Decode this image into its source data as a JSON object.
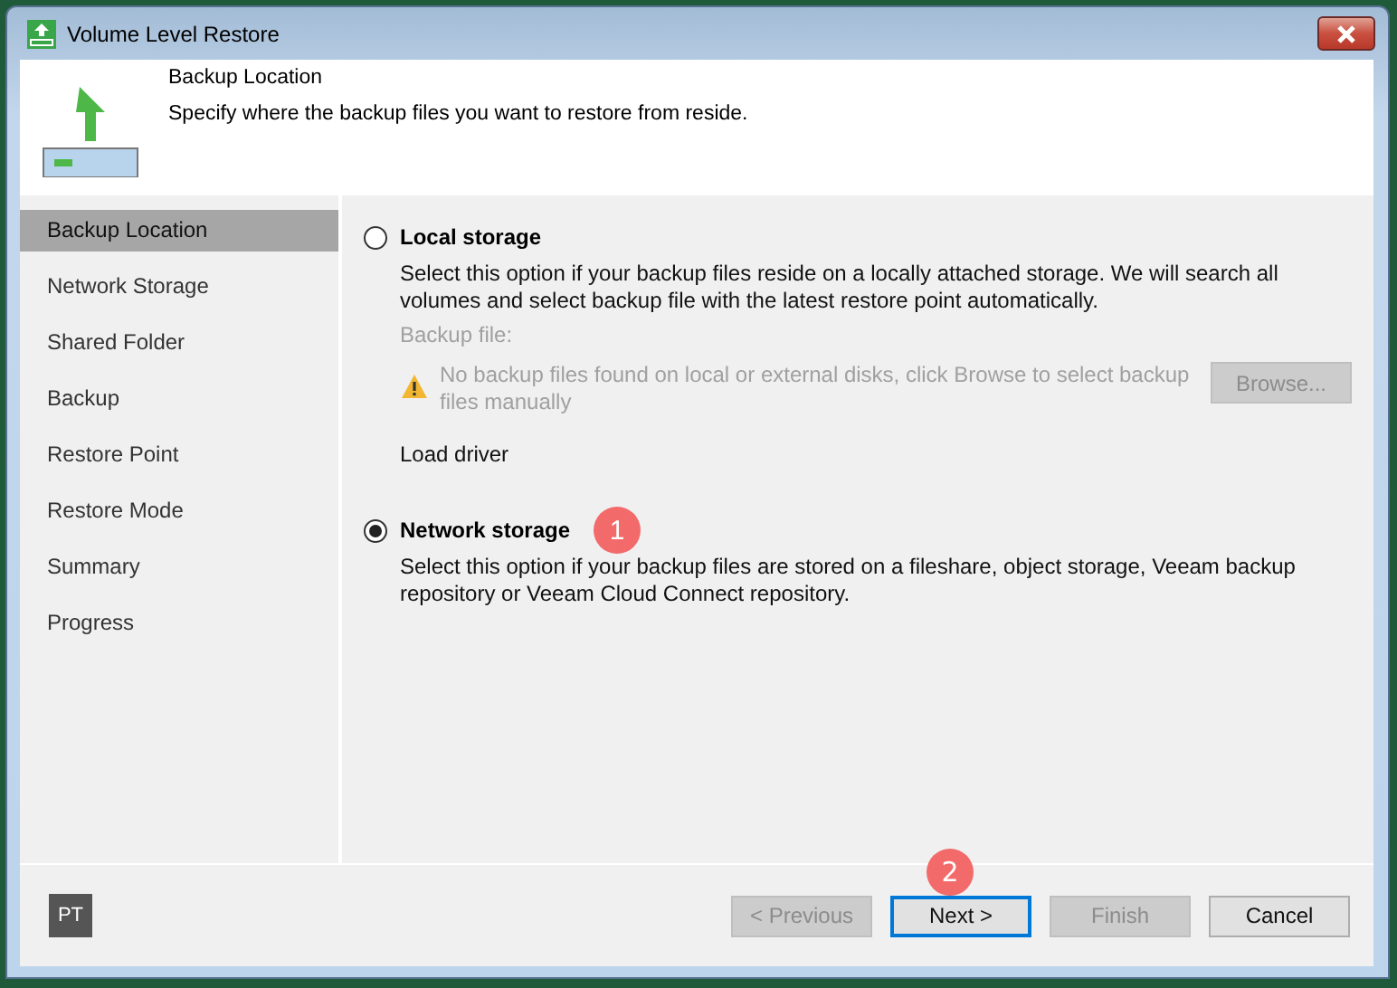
{
  "window": {
    "title": "Volume Level Restore"
  },
  "header": {
    "title": "Backup Location",
    "subtitle": "Specify where the backup files you want to restore from reside."
  },
  "steps": [
    {
      "label": "Backup Location",
      "selected": true
    },
    {
      "label": "Network Storage",
      "selected": false
    },
    {
      "label": "Shared Folder",
      "selected": false
    },
    {
      "label": "Backup",
      "selected": false
    },
    {
      "label": "Restore Point",
      "selected": false
    },
    {
      "label": "Restore Mode",
      "selected": false
    },
    {
      "label": "Summary",
      "selected": false
    },
    {
      "label": "Progress",
      "selected": false
    }
  ],
  "options": [
    {
      "label": "Local storage",
      "selected": false,
      "description": "Select this option if your backup files reside on a locally attached storage. We will search all volumes and select backup file with the latest restore point automatically.",
      "backup_file_label": "Backup file:",
      "warning": "No backup files found on local or external disks, click Browse to select backup files manually",
      "browse": {
        "label": "Browse...",
        "disabled": true
      },
      "load_driver": "Load driver"
    },
    {
      "label": "Network storage",
      "selected": true,
      "badge": "1",
      "description": "Select this option if your backup files are stored on a fileshare, object storage, Veeam backup repository or Veeam Cloud Connect repository."
    }
  ],
  "footer": {
    "avatar": "PT",
    "buttons": [
      {
        "label": "< Previous",
        "disabled": true,
        "focused": false
      },
      {
        "label": "Next >",
        "disabled": false,
        "focused": true,
        "badge": "2"
      },
      {
        "label": "Finish",
        "disabled": true,
        "focused": false
      },
      {
        "label": "Cancel",
        "disabled": false,
        "focused": false
      }
    ]
  }
}
